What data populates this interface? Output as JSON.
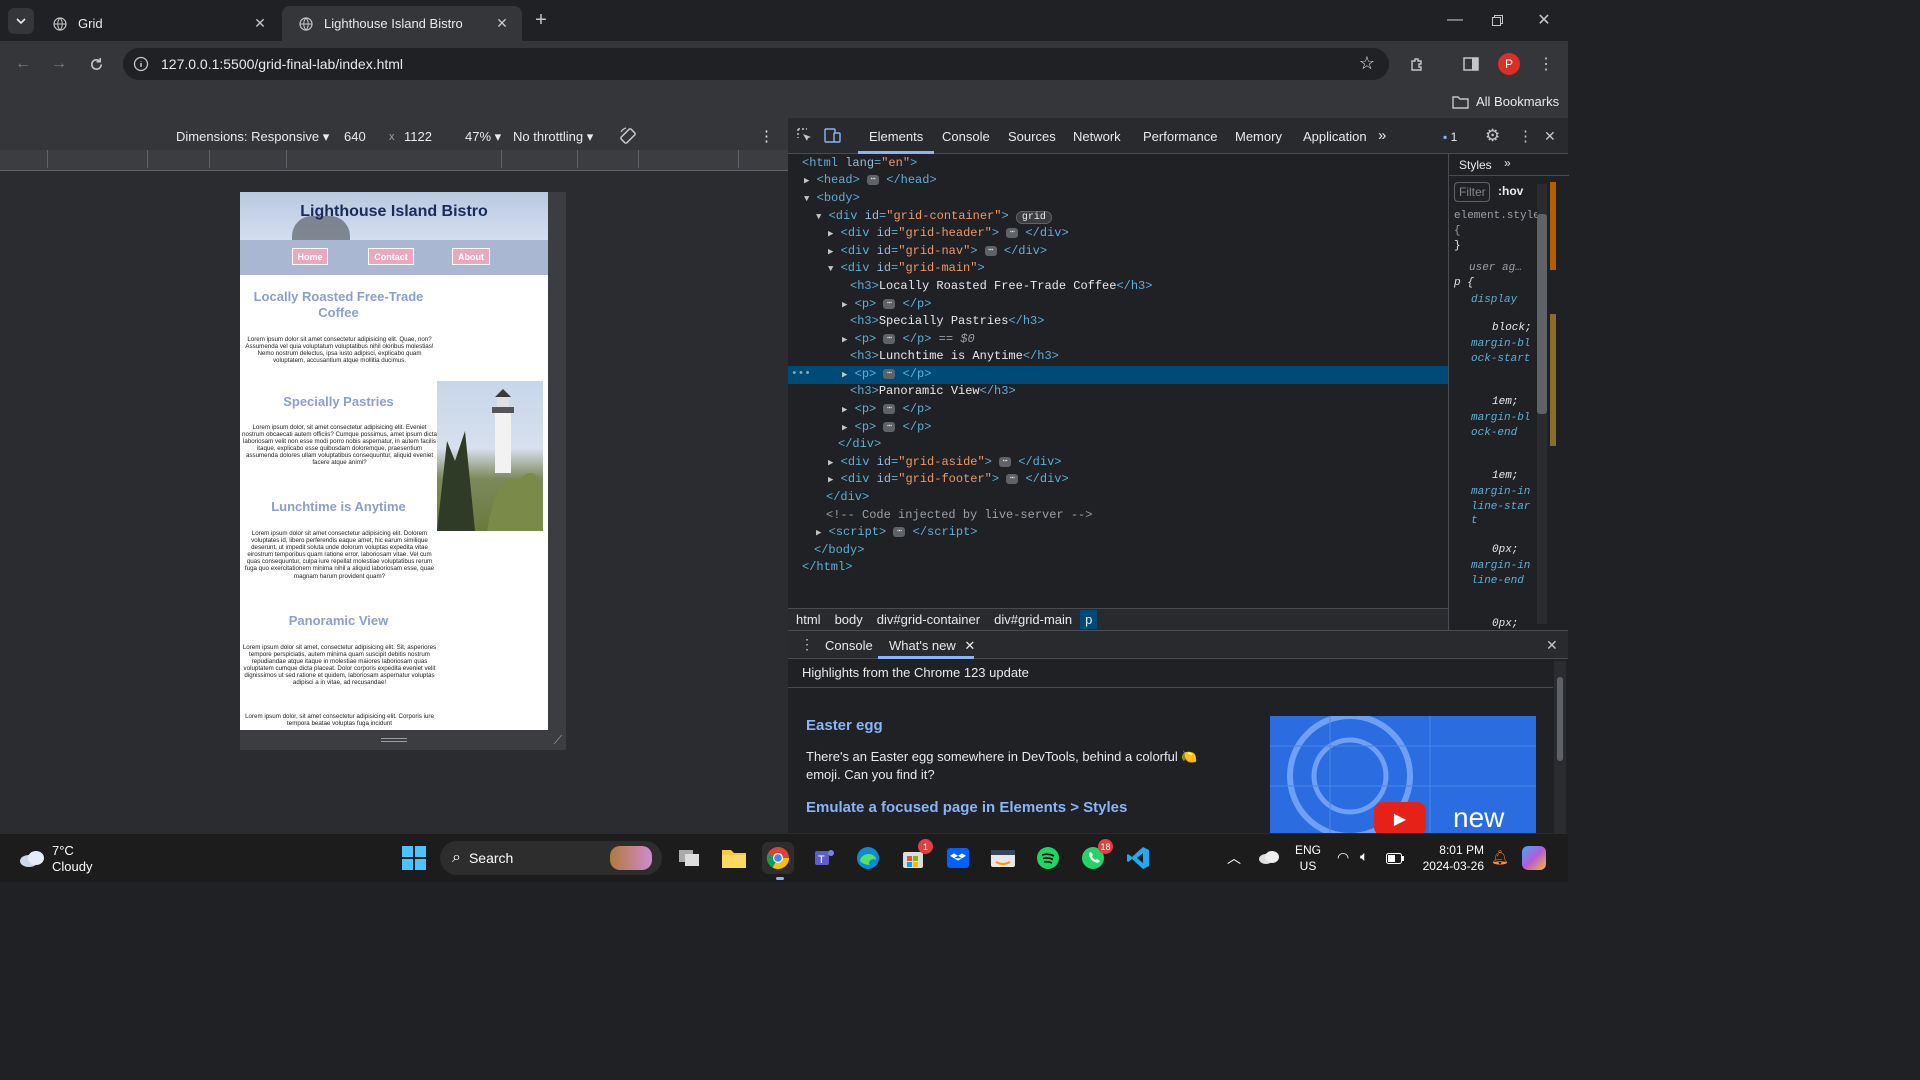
{
  "tabs": [
    {
      "label": "Grid",
      "active": false
    },
    {
      "label": "Lighthouse Island Bistro",
      "active": true
    }
  ],
  "omnibox": {
    "url": "127.0.0.1:5500/grid-final-lab/index.html"
  },
  "profile_initial": "P",
  "bookmarks": {
    "all_label": "All Bookmarks"
  },
  "device_toolbar": {
    "dimensions": "Dimensions: Responsive",
    "width": "640",
    "times": "x",
    "height": "1122",
    "zoom": "47%",
    "throttling": "No throttling"
  },
  "preview": {
    "title": "Lighthouse Island Bistro",
    "nav": [
      "Home",
      "Contact",
      "About"
    ],
    "sections": [
      {
        "heading": "Locally Roasted Free-Trade Coffee",
        "text": "Lorem ipsum dolor sit amet consectetur adipisicing elit. Quae, non? Assumenda vel quia voluptatum voluptatibus nihil oloribus molestias! Nemo nostrum delectus, ipsa iusto adipisci, explicabo quam voluptatem, accusantium atque mollitia ducimus."
      },
      {
        "heading": "Specially Pastries",
        "text": "Lorem ipsum dolor, sit amet consectetur adipisicing elit. Eveniet nostrum obcaecati autem officiis? Cumque possimus, amet ipsum dicta laboriosam velit non esse modi porro nobis aspernatur, in autem facilis itaque, explicabo esse quibusdam doloremque, praesentium assumenda dolores ullam voluptatibus consequuntur, aliquid eveniet facere atque animi?"
      },
      {
        "heading": "Lunchtime is Anytime",
        "text": "Lorem ipsum dolor sit amet consectetur adipisicing elit. Dolorem voluptates id, libero perferendis eaque amet, hic earum similique deserunt, ut impedit soluta unde dolorum voluptas expedita vitae eirostrum temporibus quam ratione error, laboriosam vitae. Vel cum quas consequuntur, culpa iure repellat molestiae voluptatibus rerum fuga quo exercitationem minima nihil a aliquid laboriosam esse, quae magnam harum provident quam?"
      },
      {
        "heading": "Panoramic View",
        "text": "Lorem ipsum dolor sit amet, consectetur adipisicing elit. Sit, asperiores tempore perspiciatis, autem minima quam suscipit debitis nostrum repudiandae atque itaque in molestiae maiores laboriosam quas voluptatem cumque dicta placeat. Dolor corporis expedita eveniet velit dignissimos ut sed ratione et quidem, laboriosam aspernatur voluptas adipisci a in vitae, ad recusandae!"
      }
    ],
    "trailing_text": "Lorem ipsum dolor, sit amet consectetur adipisicing elit. Corporis iure tempora beatae voluptas fuga incidunt"
  },
  "devtools": {
    "tabs": [
      "Elements",
      "Console",
      "Sources",
      "Network",
      "Performance",
      "Memory",
      "Application"
    ],
    "issues_count": "1",
    "dom": {
      "html_open": "<html lang=\"en\">",
      "head": "head",
      "body": "body",
      "grid_container": "grid-container",
      "grid_badge": "grid",
      "grid_header": "grid-header",
      "grid_nav": "grid-nav",
      "grid_main": "grid-main",
      "h3_1": "Locally Roasted Free-Trade Coffee",
      "h3_2": "Specially Pastries",
      "h3_3": "Lunchtime is Anytime",
      "h3_4": "Panoramic View",
      "selected_suffix": "== $0",
      "grid_aside": "grid-aside",
      "grid_footer": "grid-footer",
      "comment": "<!-- Code injected by live-server -->",
      "script": "script"
    },
    "breadcrumbs": [
      "html",
      "body",
      "div#grid-container",
      "div#grid-main",
      "p"
    ],
    "styles": {
      "tab": "Styles",
      "filter": "Filter",
      "hov": ":hov",
      "element_style": "element.style {",
      "close_brace": "}",
      "user_agent": "user ag…",
      "selector": "p {",
      "props": [
        "display",
        "margin-block-start",
        "margin-block-end",
        "margin-inline-start",
        "margin-inline-end"
      ],
      "values": [
        "block;",
        "1em;",
        "1em;",
        "0px;",
        "0px;"
      ]
    },
    "drawer": {
      "tabs": [
        "Console",
        "What's new"
      ],
      "highlights": "Highlights from the Chrome 123 update",
      "item1_title": "Easter egg",
      "item1_text": "There's an Easter egg somewhere in DevTools, behind a colorful 🍋 emoji. Can you find it?",
      "item2_title": "Emulate a focused page in Elements > Styles",
      "video_label": "new"
    }
  },
  "taskbar": {
    "weather_temp": "7°C",
    "weather_desc": "Cloudy",
    "search": "Search",
    "lang1": "ENG",
    "lang2": "US",
    "time": "8:01 PM",
    "date": "2024-03-26",
    "badge_store": "1",
    "badge_whatsapp": "18"
  },
  "colors": {
    "accent": "#8ab4f8",
    "selected_row": "#004a77",
    "preview_heading": "#8a9fd0"
  }
}
